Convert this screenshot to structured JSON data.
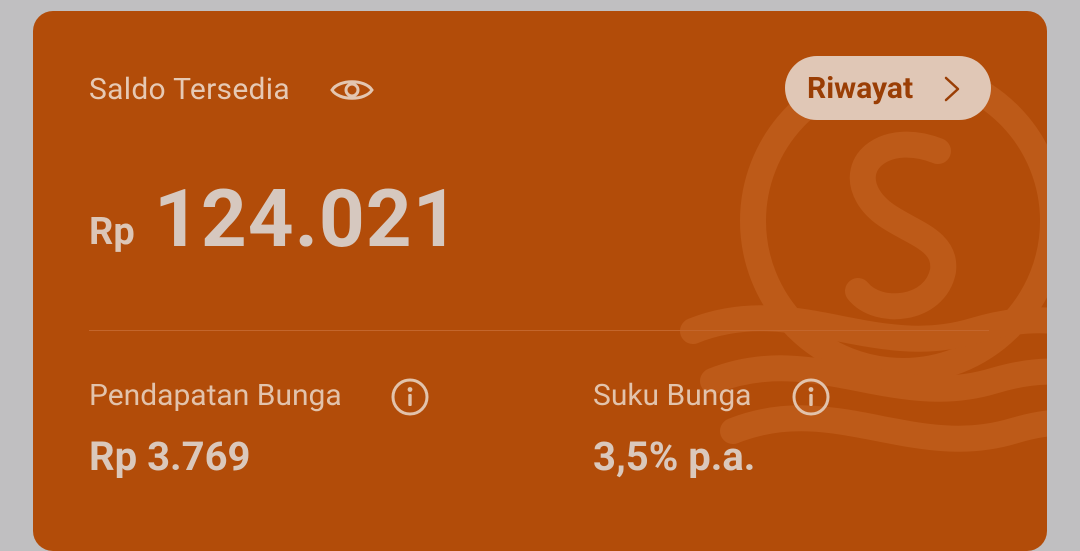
{
  "balance": {
    "label": "Saldo Tersedia",
    "currency": "Rp",
    "amount": "124.021"
  },
  "history_button": {
    "label": "Riwayat"
  },
  "stats": [
    {
      "label": "Pendapatan Bunga",
      "value": "Rp 3.769"
    },
    {
      "label": "Suku Bunga",
      "value": "3,5% p.a."
    }
  ],
  "colors": {
    "card_background": "#b24c09",
    "page_background": "#c0bfc1",
    "button_background": "#e0c7b6",
    "button_text": "#9a3e05"
  },
  "icons": [
    "eye-icon",
    "chevron-right-icon",
    "info-icon"
  ]
}
